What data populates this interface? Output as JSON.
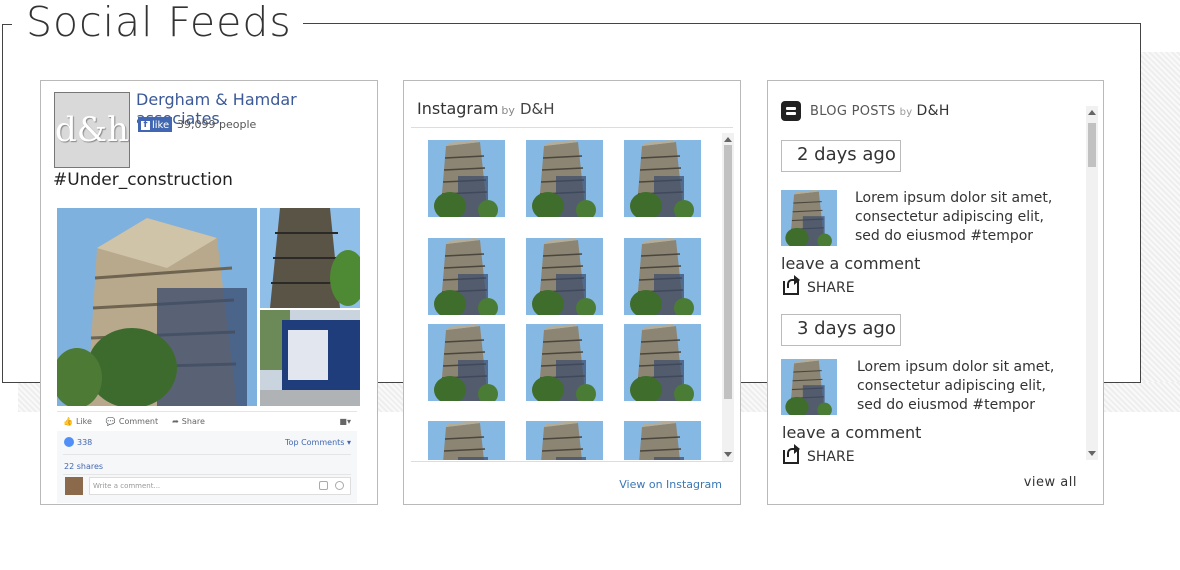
{
  "section": {
    "title": "Social Feeds"
  },
  "facebook": {
    "page_name": "Dergham & Hamdar associates",
    "logo_text": "d&h",
    "like_button": "like",
    "people_count": "39,099 people",
    "post_text": "#Under_construction",
    "actions": {
      "like": "Like",
      "comment": "Comment",
      "share": "Share"
    },
    "likes_count": "338",
    "top_comments": "Top Comments ▾",
    "shares": "22 shares",
    "comment_placeholder": "Write a comment..."
  },
  "instagram": {
    "title": "Instagram",
    "by": "by",
    "handle": "D&H",
    "view_link": "View on Instagram",
    "thumbnail_count": 15
  },
  "blog": {
    "title": "BLOG POSTS",
    "by": "by",
    "handle": "D&H",
    "posts": [
      {
        "date": "2 days ago",
        "text": "Lorem ipsum dolor sit amet, consectetur adipiscing elit, sed do eiusmod #tempor",
        "leave_comment": "leave a comment",
        "share": "SHARE"
      },
      {
        "date": "3 days ago",
        "text": "Lorem ipsum dolor sit amet, consectetur adipiscing elit, sed do eiusmod #tempor",
        "leave_comment": "leave a comment",
        "share": "SHARE"
      }
    ],
    "view_all": "view all"
  },
  "colors": {
    "facebook_blue": "#3b5998",
    "instagram_link": "#3b77b5",
    "frame": "#444444"
  }
}
